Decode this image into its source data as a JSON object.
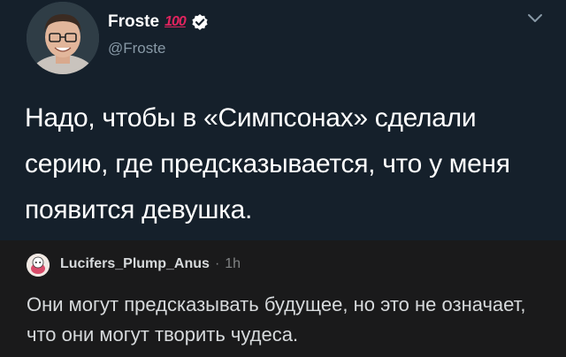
{
  "tweet": {
    "display_name": "Froste",
    "badge_emoji": "100",
    "verified_icon": "verified-badge-icon",
    "handle": "@Froste",
    "menu_icon": "chevron-down-icon",
    "text": "Надо, чтобы в «Симпсонах» сделали серию, где предсказывается, что у меня появится девушка.",
    "colors": {
      "background": "#15202b",
      "verified": "#ffffff",
      "handle": "#8899a6"
    }
  },
  "reply": {
    "username": "Lucifers_Plump_Anus",
    "separator": "·",
    "time": "1h",
    "text": "Они могут предсказывать будущее, но это не означает, что они могут творить чудеса.",
    "colors": {
      "background": "#1a1a1b",
      "text": "#d7dadc"
    }
  }
}
